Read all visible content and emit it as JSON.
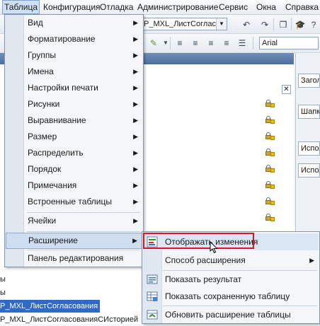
{
  "menubar": {
    "items": [
      "Таблица",
      "Конфигурация",
      "Отладка",
      "Администрирование",
      "Сервис",
      "Окна",
      "Справка"
    ]
  },
  "toolbar": {
    "doc_combo": "Р_MXL_ЛистСоглас",
    "font_combo": "Arial"
  },
  "table_menu": {
    "items": [
      {
        "label": "Вид",
        "submenu": true
      },
      {
        "label": "Форматирование",
        "submenu": true
      },
      {
        "label": "Группы",
        "submenu": true
      },
      {
        "label": "Имена",
        "submenu": true
      },
      {
        "label": "Настройки печати",
        "submenu": true
      },
      {
        "label": "Рисунки",
        "submenu": true
      },
      {
        "label": "Выравнивание",
        "submenu": true
      },
      {
        "label": "Размер",
        "submenu": true
      },
      {
        "label": "Распределить",
        "submenu": true
      },
      {
        "label": "Порядок",
        "submenu": true
      },
      {
        "label": "Примечания",
        "submenu": true
      },
      {
        "label": "Встроенные таблицы",
        "submenu": true
      },
      {
        "label": "Ячейки",
        "submenu": true
      },
      {
        "label": "Расширение",
        "submenu": true
      },
      {
        "label": "Панель редактирования",
        "submenu": false
      }
    ]
  },
  "extension_submenu": {
    "items": [
      {
        "label": "Отображать изменения",
        "icon": "show-changes-icon"
      },
      {
        "label": "Способ расширения",
        "submenu": true
      },
      {
        "label": "Показать результат",
        "icon": "show-result-icon"
      },
      {
        "label": "Показать сохраненную таблицу",
        "icon": "saved-table-icon"
      },
      {
        "label": "Обновить расширение таблицы",
        "icon": "refresh-extension-icon"
      }
    ]
  },
  "tree": {
    "items": [
      "ы",
      "ы",
      "Р_MXL_ЛистСогласования",
      "Р_MXL_ЛистСогласованияСИсторией"
    ]
  },
  "right_panel": {
    "fields": [
      "Загол",
      "Шапк",
      "Испол",
      "Испол"
    ]
  },
  "colors": {
    "highlight": "#3169c6",
    "red_frame": "#e0141e",
    "menu_bg": "#f4f6fa"
  }
}
